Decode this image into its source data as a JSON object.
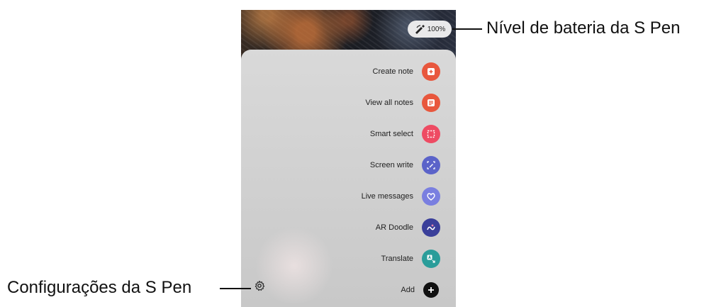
{
  "battery": {
    "value": "100%"
  },
  "menu": {
    "items": [
      {
        "label": "Create note",
        "icon": "create-note-icon",
        "color": "#e8573d"
      },
      {
        "label": "View all notes",
        "icon": "view-all-notes-icon",
        "color": "#e8573d"
      },
      {
        "label": "Smart select",
        "icon": "smart-select-icon",
        "color": "#ee4b63"
      },
      {
        "label": "Screen write",
        "icon": "screen-write-icon",
        "color": "#5b63c9"
      },
      {
        "label": "Live messages",
        "icon": "live-messages-icon",
        "color": "#7a7fe0"
      },
      {
        "label": "AR Doodle",
        "icon": "ar-doodle-icon",
        "color": "#3a3f9a"
      },
      {
        "label": "Translate",
        "icon": "translate-icon",
        "color": "#2a9d9a"
      },
      {
        "label": "Add",
        "icon": "add-icon",
        "color": "#111111"
      }
    ]
  },
  "callouts": {
    "battery_label": "Nível de bateria da S Pen",
    "settings_label": "Configurações da S Pen"
  }
}
